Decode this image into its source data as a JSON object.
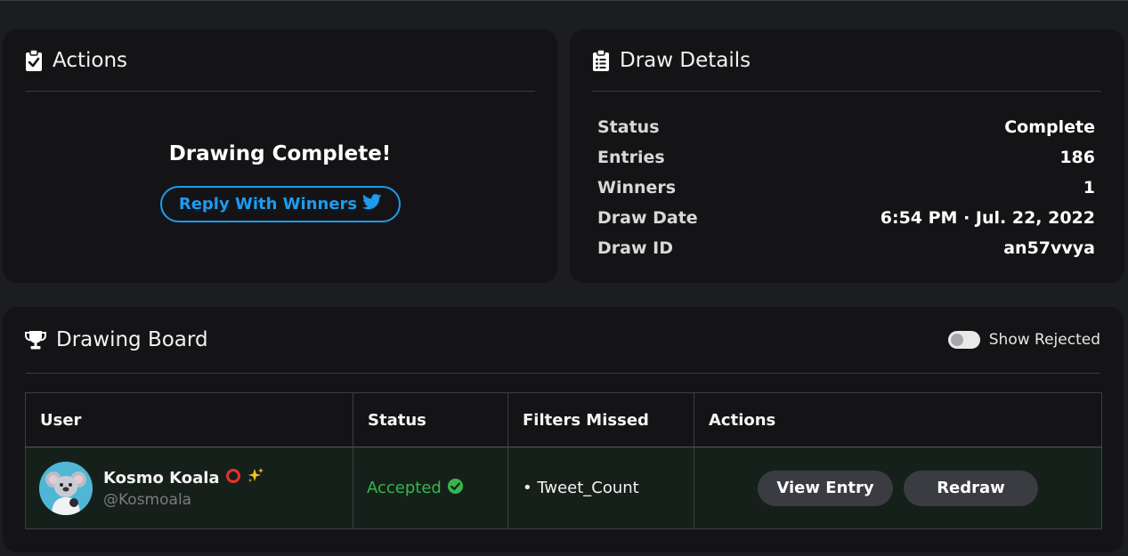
{
  "actions": {
    "title": "Actions",
    "heading": "Drawing Complete!",
    "reply_label": "Reply With Winners"
  },
  "details": {
    "title": "Draw Details",
    "rows": [
      {
        "label": "Status",
        "value": "Complete"
      },
      {
        "label": "Entries",
        "value": "186"
      },
      {
        "label": "Winners",
        "value": "1"
      },
      {
        "label": "Draw Date",
        "value": "6:54 PM · Jul. 22, 2022"
      },
      {
        "label": "Draw ID",
        "value": "an57vvya"
      }
    ]
  },
  "board": {
    "title": "Drawing Board",
    "toggle_label": "Show Rejected",
    "toggle_on": false,
    "columns": [
      "User",
      "Status",
      "Filters Missed",
      "Actions"
    ],
    "rows": [
      {
        "name": "Kosmo Koala",
        "name_emoji": [
          "red-ring-icon",
          "sparkles-icon"
        ],
        "handle": "@Kosmoala",
        "status": "Accepted",
        "filters_missed": "• Tweet_Count",
        "view_label": "View Entry",
        "redraw_label": "Redraw"
      }
    ]
  },
  "colors": {
    "accent_twitter": "#1d9bf0",
    "status_accepted": "#35b64c",
    "card_bg": "#141416",
    "page_bg": "#1c1d20"
  }
}
